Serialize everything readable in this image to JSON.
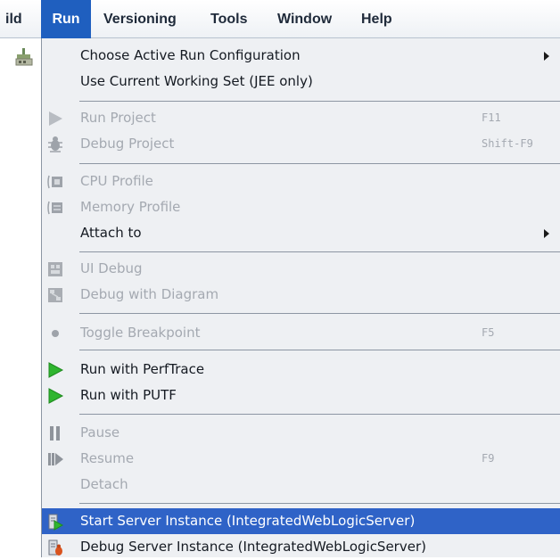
{
  "menubar": {
    "items": [
      {
        "label": "ild"
      },
      {
        "label": "Run",
        "active": true
      },
      {
        "label": "Versioning"
      },
      {
        "label": "Tools"
      },
      {
        "label": "Window"
      },
      {
        "label": "Help"
      }
    ]
  },
  "toolbar": {
    "icon": "build-tool-icon"
  },
  "menu": {
    "choose_config": "Choose Active Run Configuration",
    "use_working_set": "Use Current Working Set (JEE only)",
    "run_project": "Run Project",
    "run_project_shortcut": "F11",
    "debug_project": "Debug Project",
    "debug_project_shortcut": "Shift-F9",
    "cpu_profile": "CPU Profile",
    "memory_profile": "Memory Profile",
    "attach_to": "Attach to",
    "ui_debug": "UI Debug",
    "debug_with_diagram": "Debug with Diagram",
    "toggle_breakpoint": "Toggle Breakpoint",
    "toggle_breakpoint_shortcut": "F5",
    "run_perftrace": "Run with PerfTrace",
    "run_putf": "Run with PUTF",
    "pause": "Pause",
    "resume": "Resume",
    "resume_shortcut": "F9",
    "detach": "Detach",
    "start_server": "Start Server Instance (IntegratedWebLogicServer)",
    "debug_server": "Debug Server Instance (IntegratedWebLogicServer)"
  },
  "colors": {
    "menu_bg": "#eef0f3",
    "selection": "#2f63c7",
    "active_menu": "#1f5fbf",
    "disabled_text": "#a4a9b1",
    "run_green": "#2fb52f"
  }
}
